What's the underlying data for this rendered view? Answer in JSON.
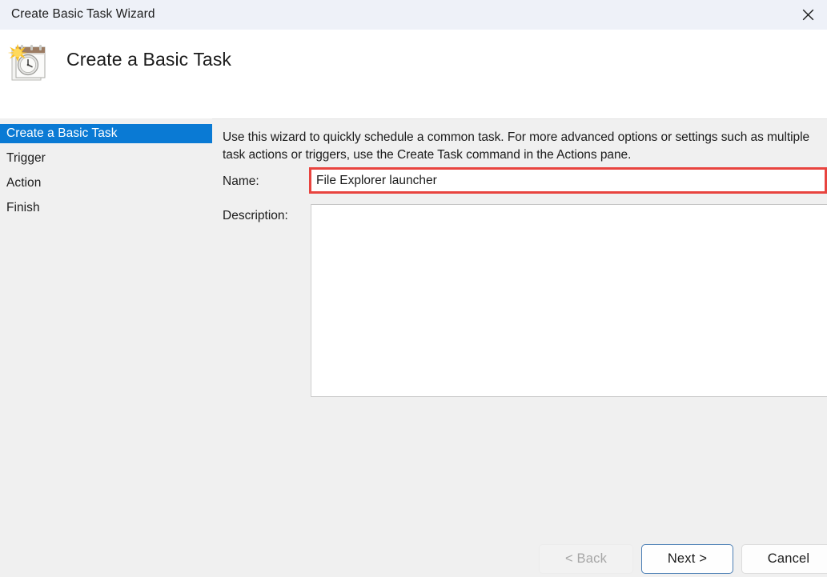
{
  "window": {
    "title": "Create Basic Task Wizard",
    "close_icon": "close-icon"
  },
  "header": {
    "icon": "create-basic-task-icon",
    "title": "Create a Basic Task"
  },
  "sidebar": {
    "items": [
      {
        "label": "Create a Basic Task",
        "selected": true
      },
      {
        "label": "Trigger",
        "selected": false
      },
      {
        "label": "Action",
        "selected": false
      },
      {
        "label": "Finish",
        "selected": false
      }
    ]
  },
  "content": {
    "intro_text": "Use this wizard to quickly schedule a common task.  For more advanced options or settings such as multiple task actions or triggers, use the Create Task command in the Actions pane.",
    "name_label": "Name:",
    "name_value": "File Explorer launcher",
    "name_placeholder": "",
    "description_label": "Description:",
    "description_value": "",
    "description_placeholder": ""
  },
  "footer": {
    "back_label": "< Back",
    "next_label": "Next >",
    "cancel_label": "Cancel"
  },
  "colors": {
    "accent_blue": "#0a7ad4",
    "highlight_red": "#e8443f",
    "default_button_border": "#4b7fb5",
    "titlebar_background": "#eef1f8",
    "body_background": "#f0f0f0"
  }
}
